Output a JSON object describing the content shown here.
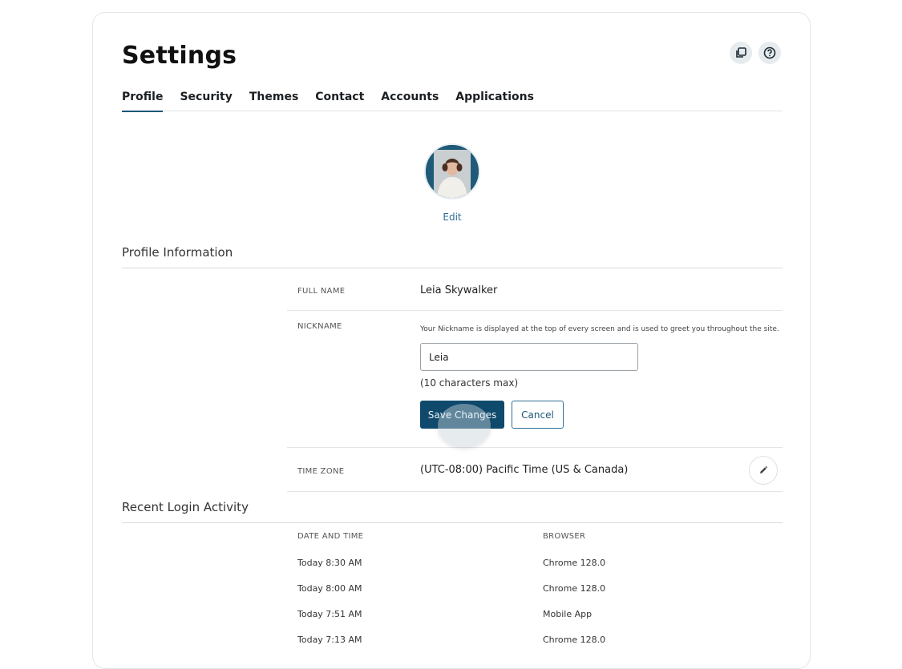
{
  "header": {
    "title": "Settings",
    "icons": [
      "copy-icon",
      "help-icon"
    ]
  },
  "tabs": [
    {
      "label": "Profile",
      "active": true
    },
    {
      "label": "Security",
      "active": false
    },
    {
      "label": "Themes",
      "active": false
    },
    {
      "label": "Contact",
      "active": false
    },
    {
      "label": "Accounts",
      "active": false
    },
    {
      "label": "Applications",
      "active": false
    }
  ],
  "avatar": {
    "edit_label": "Edit"
  },
  "profile_info": {
    "section_title": "Profile Information",
    "full_name": {
      "label": "FULL NAME",
      "value": "Leia Skywalker"
    },
    "nickname": {
      "label": "NICKNAME",
      "hint": "Your Nickname is displayed at the top of every screen and is used to greet you throughout the site.",
      "value": "Leia",
      "counter": "(10 characters max)",
      "save_label": "Save Changes",
      "cancel_label": "Cancel"
    },
    "time_zone": {
      "label": "TIME ZONE",
      "value": "(UTC-08:00) Pacific Time (US & Canada)"
    }
  },
  "login_activity": {
    "section_title": "Recent Login Activity",
    "columns": [
      "DATE AND TIME",
      "BROWSER"
    ],
    "rows": [
      [
        "Today 8:30 AM",
        "Chrome 128.0"
      ],
      [
        "Today 8:00 AM",
        "Chrome 128.0"
      ],
      [
        "Today 7:51 AM",
        "Mobile App"
      ],
      [
        "Today 7:13 AM",
        "Chrome 128.0"
      ]
    ]
  },
  "colors": {
    "primary": "#0f4a6d",
    "accent": "#1c5578",
    "link": "#2b6a93"
  }
}
